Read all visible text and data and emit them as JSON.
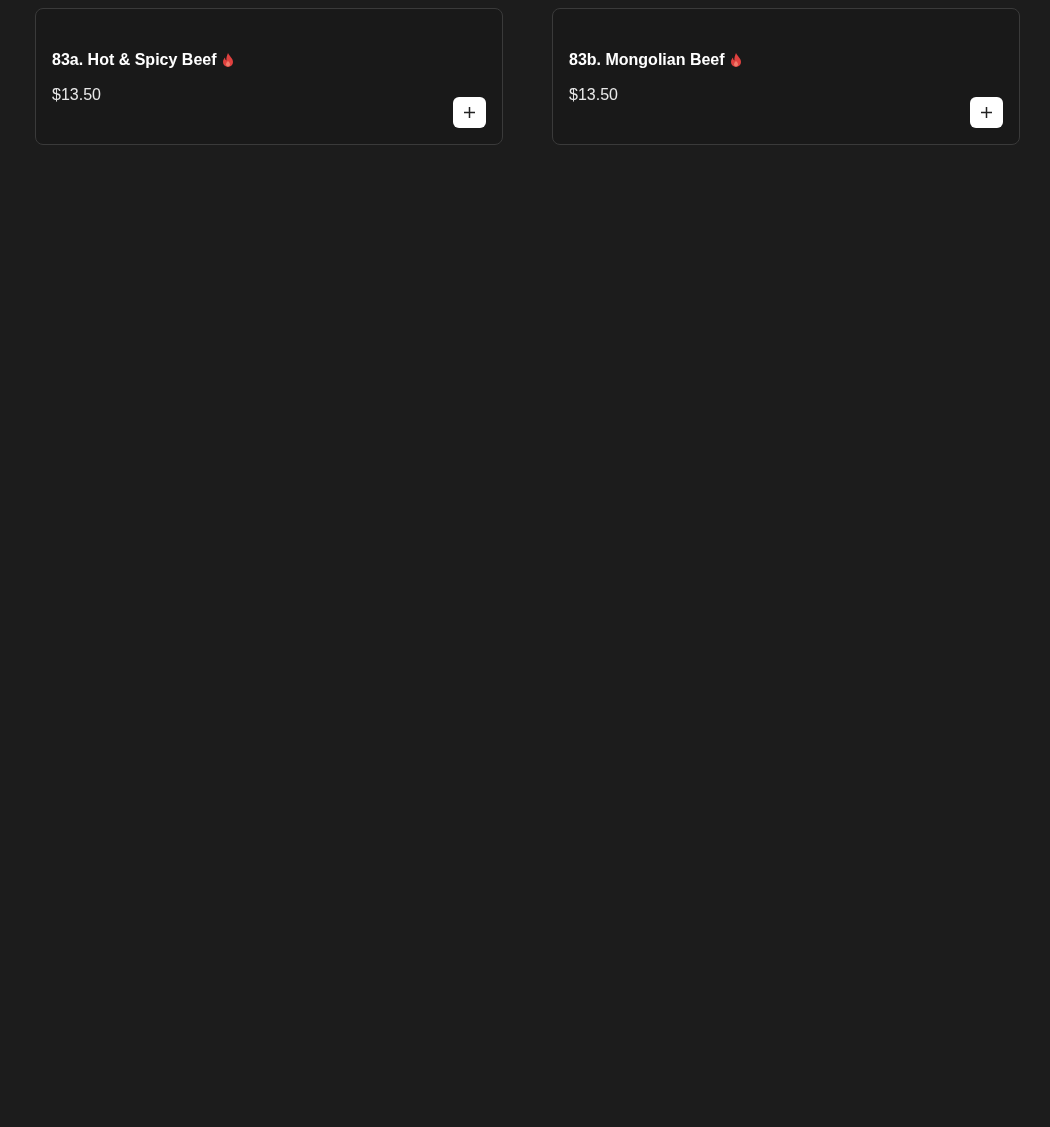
{
  "items": [
    {
      "name": "83a. Hot & Spicy Beef",
      "spicy": true,
      "price": "$13.50"
    },
    {
      "name": "83b. Mongolian Beef",
      "spicy": true,
      "price": "$13.50"
    }
  ]
}
